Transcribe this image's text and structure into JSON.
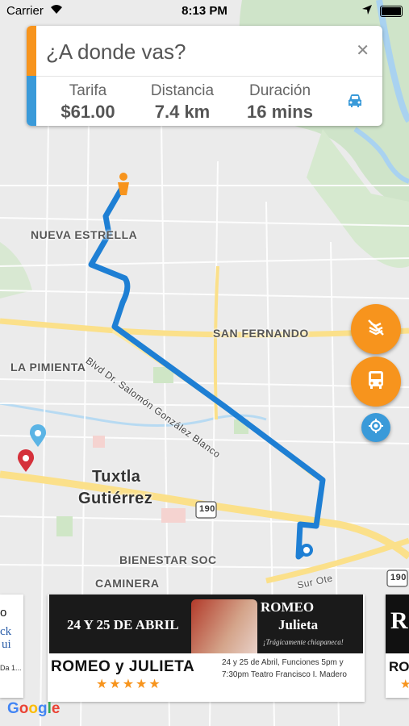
{
  "status_bar": {
    "carrier": "Carrier",
    "time": "8:13 PM"
  },
  "search": {
    "placeholder": "¿A donde vas?",
    "clear_icon": "close-icon"
  },
  "trip": {
    "fare_label": "Tarifa",
    "fare_value": "$61.00",
    "distance_label": "Distancia",
    "distance_value": "7.4 km",
    "duration_label": "Duración",
    "duration_value": "16 mins",
    "vehicle_icon": "car-icon"
  },
  "map": {
    "labels": {
      "nueva_estrella": "NUEVA ESTRELLA",
      "san_fernando": "SAN FERNANDO",
      "la_pimienta": "LA PIMIENTA",
      "blvd": "Blvd Dr. Salomón González Blanco",
      "city_line1": "Tuxtla",
      "city_line2": "Gutiérrez",
      "bienestar": "BIENESTAR SOC",
      "caminera": "CAMINERA",
      "sur_ote": "Sur Ote",
      "hwy_190a": "190",
      "hwy_190b": "190"
    },
    "route_color": "#1e7fd4",
    "accent_orange": "#f7941d",
    "accent_blue": "#3a9ad9"
  },
  "fabs": {
    "no_route_icon": "route-off-icon",
    "bus_icon": "bus-icon",
    "locate_icon": "my-location-icon"
  },
  "ads": {
    "main": {
      "banner_date": "24 Y 25 DE ABRIL",
      "banner_title1": "ROMEO",
      "banner_title2": "Julieta",
      "banner_tagline": "¡Trágicamente chiapaneca!",
      "title": "ROMEO y JULIETA",
      "stars": "★★★★★",
      "description": "24 y 25 de Abril, Funciones 5pm y 7:30pm Teatro Francisco I. Madero"
    },
    "left_partial": {
      "line1": "o",
      "line2": "ck",
      "line3": "ui",
      "line4": "Da 1..."
    },
    "right_partial": {
      "line1": "R",
      "line2": "RO",
      "stars": "★"
    }
  },
  "google_logo": "Google"
}
